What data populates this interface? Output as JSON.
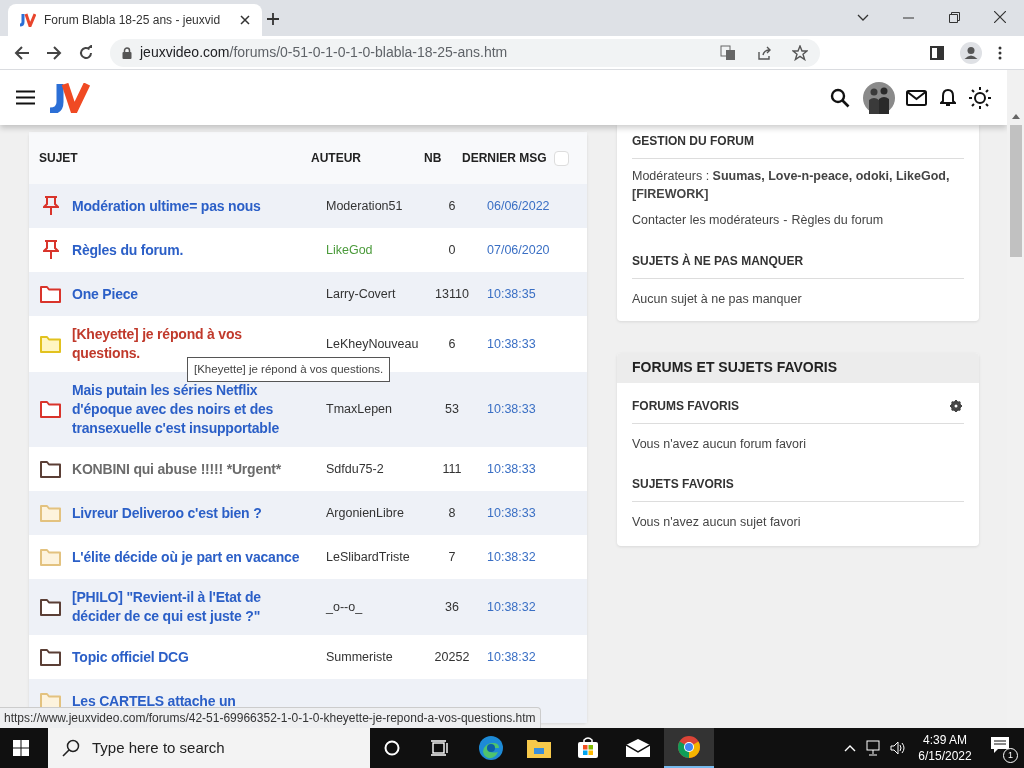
{
  "browser": {
    "tab_title": "Forum Blabla 18-25 ans - jeuxvid",
    "url_host": "jeuxvideo.com",
    "url_path": "/forums/0-51-0-1-0-1-0-blabla-18-25-ans.htm",
    "status_url": "https://www.jeuxvideo.com/forums/42-51-69966352-1-0-1-0-kheyette-je-repond-a-vos-questions.htm"
  },
  "forum": {
    "columns": [
      "SUJET",
      "AUTEUR",
      "NB",
      "DERNIER MSG"
    ],
    "select_all": {
      "checked": false
    },
    "topics": [
      {
        "kind": "pin",
        "title": "Modération ultime= pas nous",
        "color": "#2b5fc7",
        "author": {
          "name": "Moderation51",
          "color": "#333333"
        },
        "count": "6",
        "last": "06/06/2022"
      },
      {
        "kind": "pin",
        "title": "Règles du forum.",
        "color": "#2b5fc7",
        "author": {
          "name": "LikeGod",
          "color": "#4a9a3a"
        },
        "count": "0",
        "last": "07/06/2020"
      },
      {
        "kind": "folder-red",
        "title": "One Piece",
        "color": "#2b5fc7",
        "author": {
          "name": "Larry-Covert",
          "color": "#333333"
        },
        "count": "13110",
        "last": "10:38:35"
      },
      {
        "kind": "folder-yellow",
        "title": "[Kheyette] je répond à vos questions.",
        "color": "#c0392b",
        "author": {
          "name": "LeKheyNouveau",
          "color": "#333333"
        },
        "count": "6",
        "last": "10:38:33"
      },
      {
        "kind": "folder-red",
        "title": "Mais putain les séries Netflix d'époque avec des noirs et des transexuelle c'est insupportable",
        "color": "#2b5fc7",
        "author": {
          "name": "TmaxLepen",
          "color": "#333333"
        },
        "count": "53",
        "last": "10:38:33"
      },
      {
        "kind": "folder-brown",
        "title": "KONBINI qui abuse !!!!! *Urgent*",
        "color": "#6b6b6b",
        "author": {
          "name": "Sdfdu75-2",
          "color": "#333333"
        },
        "count": "111",
        "last": "10:38:33"
      },
      {
        "kind": "folder-beige",
        "title": "Livreur Deliveroo c'est bien ?",
        "color": "#2b5fc7",
        "author": {
          "name": "ArgonienLibre",
          "color": "#333333"
        },
        "count": "8",
        "last": "10:38:33"
      },
      {
        "kind": "folder-beige",
        "title": "L'élite décide où je part en vacance",
        "color": "#2b5fc7",
        "author": {
          "name": "LeSlibardTriste",
          "color": "#333333"
        },
        "count": "7",
        "last": "10:38:32"
      },
      {
        "kind": "folder-brown",
        "title": "[PHILO] \"Revient-il à l'Etat de décider de ce qui est juste ?\"",
        "color": "#2b5fc7",
        "author": {
          "name": "_o--o_",
          "color": "#333333"
        },
        "count": "36",
        "last": "10:38:32"
      },
      {
        "kind": "folder-brown",
        "title": "Topic officiel DCG",
        "color": "#2b5fc7",
        "author": {
          "name": "Summeriste",
          "color": "#333333"
        },
        "count": "20252",
        "last": "10:38:32"
      },
      {
        "kind": "folder-beige",
        "title": "Les CARTELS attache un",
        "color": "#2b5fc7"
      }
    ],
    "tooltip": "[Kheyette] je répond à vos questions."
  },
  "sidebar": {
    "management": {
      "heading": "GESTION DU FORUM",
      "moderators": "Modérateurs : **Suumas, Love-n-peace, odoki, LikeGod, [FIREWORK]**",
      "links": [
        "Contacter les modérateurs",
        "Règles du forum"
      ],
      "separator": "-",
      "must_see_heading": "SUJETS À NE PAS MANQUER",
      "must_see_empty": "Aucun sujet à ne pas manquer"
    },
    "favorites": {
      "title": "FORUMS ET SUJETS FAVORIS",
      "forums_heading": "FORUMS FAVORIS",
      "forums_empty": "Vous n'avez aucun forum favori",
      "topics_heading": "SUJETS FAVORIS",
      "topics_empty": "Vous n'avez aucun sujet favori"
    }
  },
  "taskbar": {
    "search_placeholder": "Type here to search",
    "time": "4:39 AM",
    "date": "6/15/2022",
    "notifications": "1"
  }
}
